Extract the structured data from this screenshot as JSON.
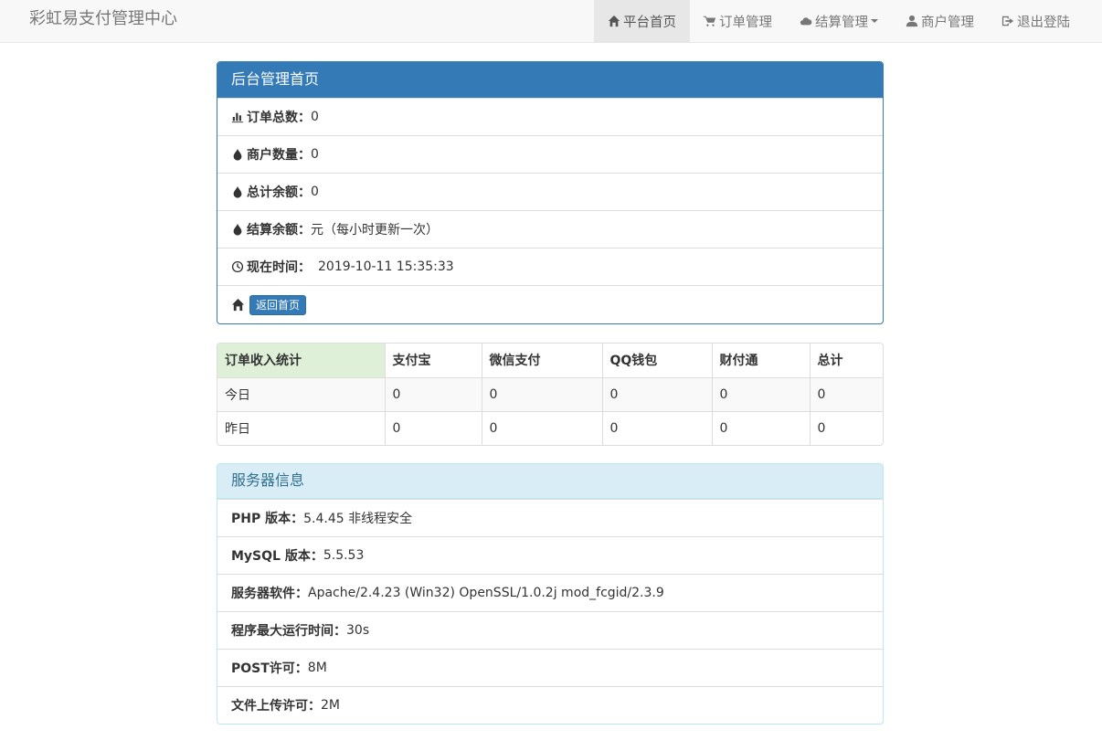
{
  "navbar": {
    "brand": "彩虹易支付管理中心",
    "items": [
      {
        "label": "平台首页",
        "icon": "home-icon",
        "active": true
      },
      {
        "label": "订单管理",
        "icon": "cart-icon"
      },
      {
        "label": "结算管理",
        "icon": "cloud-icon",
        "dropdown": true
      },
      {
        "label": "商户管理",
        "icon": "user-icon"
      },
      {
        "label": "退出登陆",
        "icon": "logout-icon"
      }
    ]
  },
  "admin_panel": {
    "title": "后台管理首页",
    "rows": [
      {
        "icon": "bar-chart-icon",
        "label": "订单总数：",
        "value": "0"
      },
      {
        "icon": "tint-icon",
        "label": "商户数量：",
        "value": "0"
      },
      {
        "icon": "tint-icon",
        "label": "总计余额：",
        "value": "0"
      },
      {
        "icon": "tint-icon",
        "label": "结算余额：",
        "value": "元（每小时更新一次）"
      },
      {
        "icon": "clock-icon",
        "label": "现在时间：",
        "value": "2019-10-11 15:35:33"
      }
    ],
    "home_button": "返回首页"
  },
  "stats_table": {
    "headers": [
      "订单收入统计",
      "支付宝",
      "微信支付",
      "QQ钱包",
      "财付通",
      "总计"
    ],
    "rows": [
      [
        "今日",
        "0",
        "0",
        "0",
        "0",
        "0"
      ],
      [
        "昨日",
        "0",
        "0",
        "0",
        "0",
        "0"
      ]
    ]
  },
  "server_panel": {
    "title": "服务器信息",
    "rows": [
      {
        "label": "PHP 版本：",
        "value": "5.4.45 非线程安全"
      },
      {
        "label": "MySQL 版本：",
        "value": "5.5.53"
      },
      {
        "label": "服务器软件：",
        "value": "Apache/2.4.23 (Win32) OpenSSL/1.0.2j mod_fcgid/2.3.9"
      },
      {
        "label": "程序最大运行时间：",
        "value": "30s"
      },
      {
        "label": "POST许可：",
        "value": "8M"
      },
      {
        "label": "文件上传许可：",
        "value": "2M"
      }
    ]
  },
  "colors": {
    "primary": "#337ab7",
    "info_bg": "#d9edf7",
    "success_bg": "#dff0d8"
  }
}
